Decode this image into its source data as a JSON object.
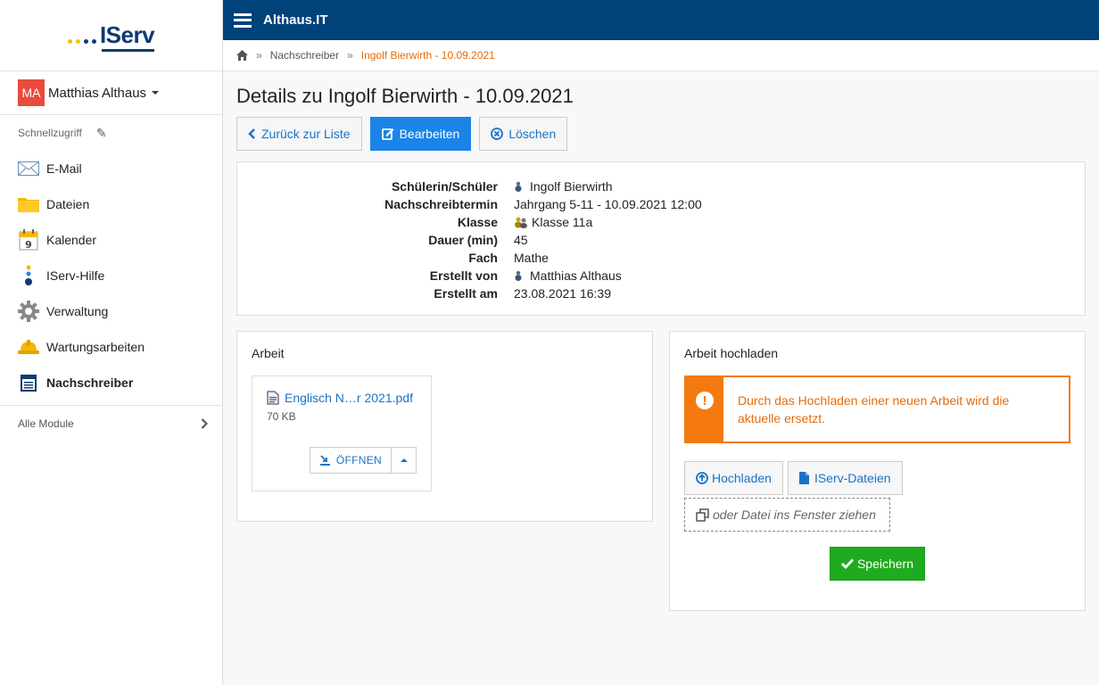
{
  "brand": {
    "logo_text": "IServ"
  },
  "topbar": {
    "title": "Althaus.IT"
  },
  "user": {
    "initials": "MA",
    "name": "Matthias Althaus"
  },
  "sidebar": {
    "quick_access_label": "Schnellzugriff",
    "items": [
      {
        "label": "E-Mail",
        "icon": "mail-icon"
      },
      {
        "label": "Dateien",
        "icon": "folder-icon"
      },
      {
        "label": "Kalender",
        "icon": "calendar-icon"
      },
      {
        "label": "IServ-Hilfe",
        "icon": "help-icon"
      },
      {
        "label": "Verwaltung",
        "icon": "gear-icon"
      },
      {
        "label": "Wartungsarbeiten",
        "icon": "hardhat-icon"
      },
      {
        "label": "Nachschreiber",
        "icon": "list-icon"
      }
    ],
    "all_modules_label": "Alle Module"
  },
  "breadcrumb": {
    "parent": "Nachschreiber",
    "current": "Ingolf Bierwirth - 10.09.2021"
  },
  "page": {
    "title": "Details zu Ingolf Bierwirth - 10.09.2021",
    "buttons": {
      "back": "Zurück zur Liste",
      "edit": "Bearbeiten",
      "delete": "Löschen"
    }
  },
  "details": [
    {
      "label": "Schülerin/Schüler",
      "value": "Ingolf Bierwirth"
    },
    {
      "label": "Nachschreibtermin",
      "value": "Jahrgang 5-11 - 10.09.2021 12:00"
    },
    {
      "label": "Klasse",
      "value": "Klasse 11a"
    },
    {
      "label": "Dauer (min)",
      "value": "45"
    },
    {
      "label": "Fach",
      "value": "Mathe"
    },
    {
      "label": "Erstellt von",
      "value": "Matthias Althaus"
    },
    {
      "label": "Erstellt am",
      "value": "23.08.2021 16:39"
    }
  ],
  "arbeit": {
    "title": "Arbeit",
    "file_name": "Englisch N…r 2021.pdf",
    "file_size": "70 KB",
    "open_label": "ÖFFNEN"
  },
  "upload": {
    "title": "Arbeit hochladen",
    "warning": "Durch das Hochladen einer neuen Arbeit wird die aktuelle ersetzt.",
    "upload_button": "Hochladen",
    "iserv_files_button": "IServ-Dateien",
    "drop_text": "oder Datei ins Fenster ziehen",
    "save_button": "Speichern"
  },
  "colors": {
    "topbar": "#00427a",
    "primary": "#1a84e8",
    "accent": "#e46c0a",
    "success": "#1fab1f"
  }
}
